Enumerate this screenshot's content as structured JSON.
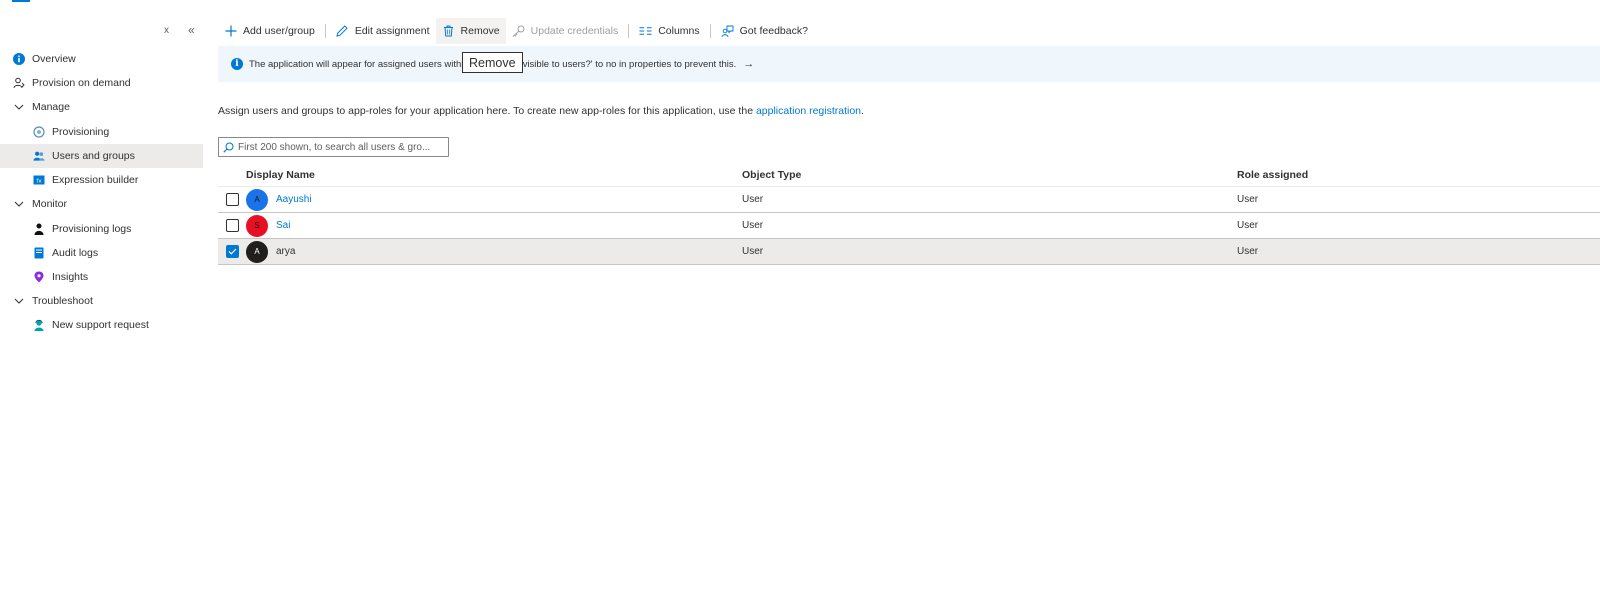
{
  "sidebar": {
    "close_label": "x",
    "collapse_label": "«",
    "items": [
      {
        "label": "Overview"
      },
      {
        "label": "Provision on demand"
      },
      {
        "label": "Manage"
      },
      {
        "label": "Provisioning"
      },
      {
        "label": "Users and groups"
      },
      {
        "label": "Expression builder"
      },
      {
        "label": "Monitor"
      },
      {
        "label": "Provisioning logs"
      },
      {
        "label": "Audit logs"
      },
      {
        "label": "Insights"
      },
      {
        "label": "Troubleshoot"
      },
      {
        "label": "New support request"
      }
    ]
  },
  "toolbar": {
    "add": "Add user/group",
    "edit": "Edit assignment",
    "remove": "Remove",
    "update": "Update credentials",
    "columns": "Columns",
    "feedback": "Got feedback?"
  },
  "banner": {
    "text_before": "The application will appear for assigned users within",
    "text_after": "visible to users?' to no in properties to prevent this.",
    "arrow": "→"
  },
  "tooltip": "Remove",
  "description": {
    "text": "Assign users and groups to app-roles for your application here. To create new app-roles for this application, use the ",
    "link": "application registration",
    "end": "."
  },
  "search": {
    "placeholder": "First 200 shown, to search all users & gro..."
  },
  "table": {
    "columns": [
      "Display Name",
      "Object Type",
      "Role assigned"
    ],
    "rows": [
      {
        "initial": "A",
        "name": "Aayushi",
        "type": "User",
        "role": "User",
        "checked": false,
        "color": "#1a73e8"
      },
      {
        "initial": "S",
        "name": "Sai",
        "type": "User",
        "role": "User",
        "checked": false,
        "color": "#e81123"
      },
      {
        "initial": "A",
        "name": "arya",
        "type": "User",
        "role": "User",
        "checked": true,
        "color": "#201f1e"
      }
    ]
  },
  "colors": {
    "accent": "#0078d4",
    "banner_bg": "#eff6fc",
    "selected_bg": "#edebe9"
  }
}
